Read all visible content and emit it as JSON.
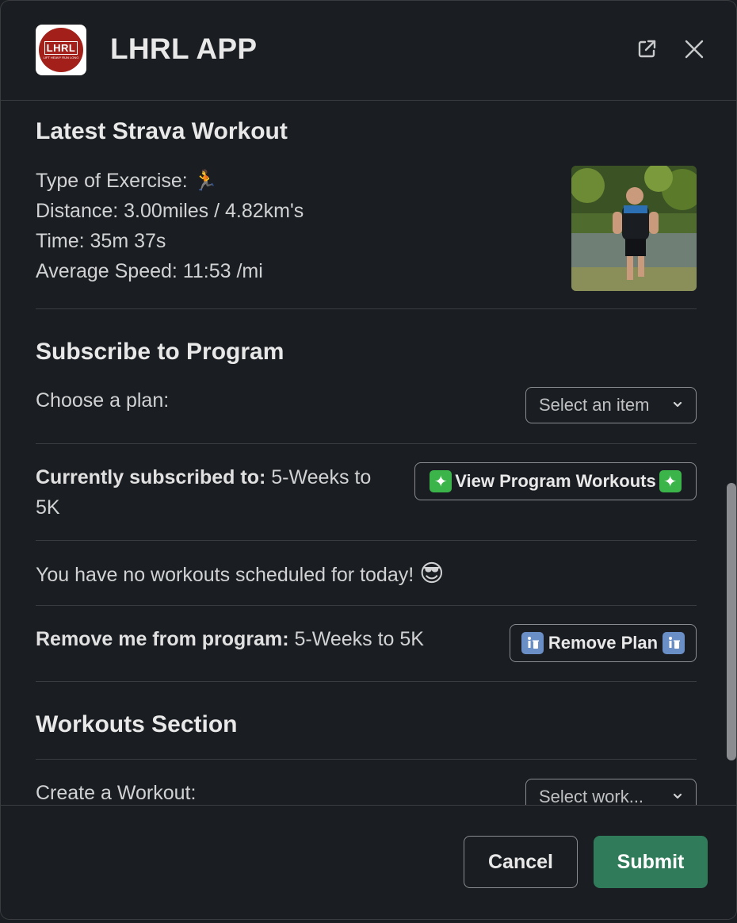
{
  "header": {
    "logo_text": "LHRL",
    "logo_subtext": "LIFT HEAVY RUN LONG",
    "title": "LHRL APP",
    "open_external_icon": "external-link-icon",
    "close_icon": "close-icon"
  },
  "strava": {
    "heading": "Latest Strava Workout",
    "type_label": "Type of Exercise:",
    "type_emoji": "🏃",
    "distance": "Distance: 3.00miles / 4.82km's",
    "time": "Time: 35m 37s",
    "avg_speed": "Average Speed: 11:53 /mi"
  },
  "subscribe": {
    "heading": "Subscribe to Program",
    "choose_label": "Choose a plan:",
    "plan_select_placeholder": "Select an item"
  },
  "current": {
    "label": "Currently subscribed to:",
    "value_line1": "5-Weeks to",
    "value_line2": "5K",
    "view_button": "View Program Workouts",
    "sparkle": "✦"
  },
  "today": {
    "text": "You have no workouts scheduled for today!",
    "emoji": "😎"
  },
  "remove": {
    "label": "Remove me from program:",
    "value": "5-Weeks to 5K",
    "button": "Remove Plan"
  },
  "workouts": {
    "heading": "Workouts Section",
    "create_label": "Create a Workout:",
    "select_placeholder": "Select work..."
  },
  "footer": {
    "cancel": "Cancel",
    "submit": "Submit"
  },
  "colors": {
    "background": "#1a1d21",
    "submit": "#2f7b5a",
    "logo_red": "#a3201a"
  }
}
